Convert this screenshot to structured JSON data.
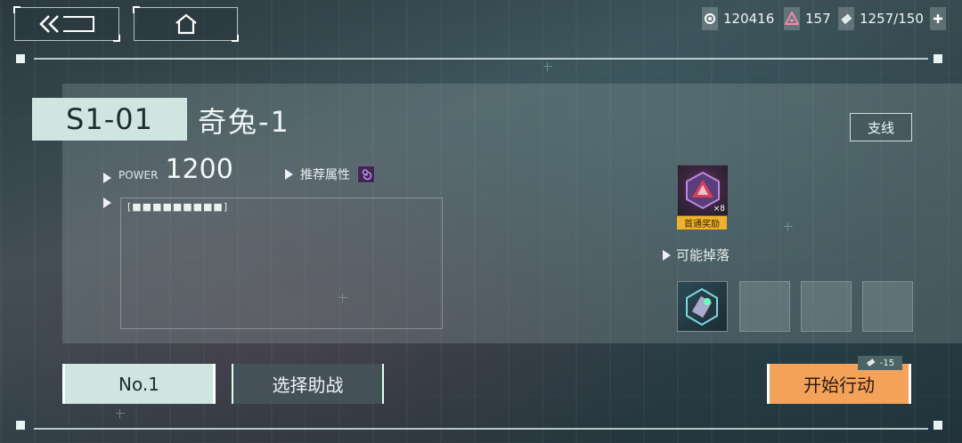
{
  "top_bar": {
    "back_icon": "double-chevron-left-icon",
    "home_icon": "home-icon",
    "resources": [
      {
        "icon": "coin-icon",
        "value": "120416"
      },
      {
        "icon": "crystal-icon",
        "value": "157"
      },
      {
        "icon": "ticket-icon",
        "value": "1257/150"
      }
    ],
    "add_icon": "plus-icon"
  },
  "stage": {
    "id": "S1-01",
    "name": "奇兔-1",
    "power_label": "POWER",
    "power_value": "1200",
    "recommended_attr_label": "推荐属性",
    "attr_icon": "spiral-icon",
    "hp_bar": "[■■■■■■■■■]",
    "branch_label": "支线"
  },
  "rewards": {
    "first_clear_count": "×8",
    "first_clear_tag": "首通奖励",
    "possible_drops_label": "可能掉落"
  },
  "actions": {
    "team_label": "No.1",
    "support_label": "选择助战",
    "start_label": "开始行动",
    "cost": "-15"
  },
  "colors": {
    "accent_light": "#cfe6e0",
    "start_orange": "#f4a25a",
    "reward_gold": "#f0b22a"
  }
}
